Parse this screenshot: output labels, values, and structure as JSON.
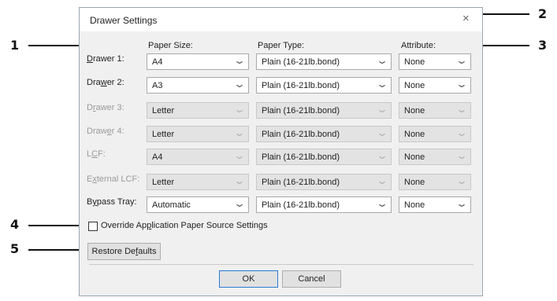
{
  "dialog": {
    "title": "Drawer Settings",
    "close_glyph": "×",
    "headers": {
      "paper_size": "Paper Size:",
      "paper_type": "Paper Type:",
      "attribute": "Attribute:"
    },
    "rows": [
      {
        "label_pre": "",
        "label_ul": "D",
        "label_post": "rawer 1:",
        "size": "A4",
        "type": "Plain (16-21lb.bond)",
        "attribute": "None",
        "disabled": false
      },
      {
        "label_pre": "Dra",
        "label_ul": "w",
        "label_post": "er 2:",
        "size": "A3",
        "type": "Plain (16-21lb.bond)",
        "attribute": "None",
        "disabled": false
      },
      {
        "label_pre": "D",
        "label_ul": "r",
        "label_post": "awer 3:",
        "size": "Letter",
        "type": "Plain (16-21lb.bond)",
        "attribute": "None",
        "disabled": true
      },
      {
        "label_pre": "Draw",
        "label_ul": "e",
        "label_post": "r 4:",
        "size": "Letter",
        "type": "Plain (16-21lb.bond)",
        "attribute": "None",
        "disabled": true
      },
      {
        "label_pre": "L",
        "label_ul": "C",
        "label_post": "F:",
        "size": "A4",
        "type": "Plain (16-21lb.bond)",
        "attribute": "None",
        "disabled": true
      },
      {
        "label_pre": "E",
        "label_ul": "x",
        "label_post": "ternal LCF:",
        "size": "Letter",
        "type": "Plain (16-21lb.bond)",
        "attribute": "None",
        "disabled": true
      },
      {
        "label_pre": "B",
        "label_ul": "y",
        "label_post": "pass Tray:",
        "size": "Automatic",
        "type": "Plain (16-21lb.bond)",
        "attribute": "None",
        "disabled": false
      }
    ],
    "override_pre": "Override Ap",
    "override_ul": "p",
    "override_post": "lication Paper Source Settings",
    "restore_pre": "Restore De",
    "restore_ul": "f",
    "restore_post": "aults",
    "ok_label": "OK",
    "cancel_label": "Cancel"
  },
  "callouts": [
    "1",
    "2",
    "3",
    "4",
    "5"
  ]
}
